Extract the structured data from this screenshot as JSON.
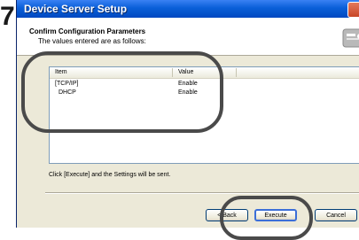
{
  "step": {
    "number": "7"
  },
  "window": {
    "title": "Device Server Setup"
  },
  "header": {
    "title": "Confirm Configuration Parameters",
    "subtitle": "The values entered are as follows:",
    "icon": "setup-wizard-icon"
  },
  "table": {
    "columns": [
      "Item",
      "Value"
    ],
    "rows": [
      {
        "item": "[TCP/IP]",
        "value": "Enable"
      },
      {
        "item": "DHCP",
        "value": "Enable"
      }
    ]
  },
  "footer_note": "Click [Execute] and the Settings will be sent.",
  "buttons": {
    "back": "< Back",
    "execute": "Execute",
    "cancel": "Cancel"
  },
  "colors": {
    "titlebar": "#0a5fd8",
    "highlight_ring": "#4a4a4a"
  }
}
